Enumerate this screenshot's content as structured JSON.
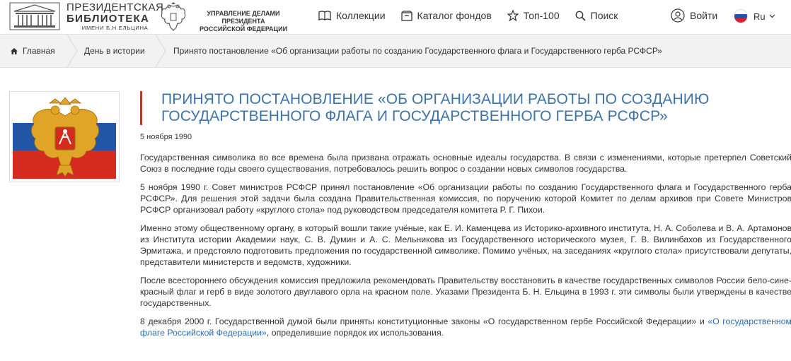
{
  "header": {
    "logo": {
      "line1": "ПРЕЗИДЕНТСКАЯ",
      "line2": "БИБЛИОТЕКА",
      "line3": "ИМЕНИ Б.Н.ЕЛЬЦИНА"
    },
    "udp": {
      "line1": "УПРАВЛЕНИЕ ДЕЛАМИ ПРЕЗИДЕНТА",
      "line2": "РОССИЙСКОЙ ФЕДЕРАЦИИ"
    },
    "nav": {
      "collections": "Коллекции",
      "catalog": "Каталог фондов",
      "top100": "Топ-100",
      "search": "Поиск"
    },
    "login": "Войти",
    "lang": "Ru"
  },
  "breadcrumb": {
    "home": "Главная",
    "section": "День в истории",
    "current": "Принято постановление «Об организации работы по созданию Государственного флага и Государственного герба РСФСР»"
  },
  "article": {
    "title_line1": "Принято постановление «Об организации работы по созданию",
    "title_line2": "Государственного флага и Государственного герба РСФСР»",
    "date": "5 ноября 1990",
    "p1": "Государственная символика во все времена была призвана отражать основные идеалы государства. В связи с изменениями, которые претерпел Советский Союз в последние годы своего существования, потребовалось решить вопрос о создании новых символов государства.",
    "p2": "5 ноября 1990 г. Совет министров РСФСР принял постановление «Об организации работы по созданию Государственного флага и Государственного герба РСФСР». Для решения этой задачи была создана Правительственная комиссия, по поручению которой Комитет по делам архивов при Совете Министров РСФСР организовал работу «круглого стола» под руководством председателя комитета Р. Г. Пихои.",
    "p3": "Именно этому общественному органу, в который вошли такие учёные, как Е. И. Каменцева из Историко-архивного института, Н. А. Соболева и В. А. Артамонов из Института истории Академии наук, С. В. Думин и А. С. Мельникова из Государственного исторического музея, Г. В. Вилинбахов из Государственного Эрмитажа, и предстояло подготовить предложения по государственной символике. Помимо учёных, на заседаниях «круглого стола» присутствовали депутаты, представители министерств и ведомств, художники.",
    "p4": "После всестороннего обсуждения комиссия предложила рекомендовать Правительству восстановить в качестве государственных символов России бело-сине-красный флаг и герб в виде золотого двуглавого орла на красном поле. Указами Президента Б. Н. Ельцина в 1993 г. эти символы были утверждены в качестве государственных.",
    "p5_start": "8 декабря 2000 г. Государственной думой были приняты конституционные законы «О государственном гербе Российской Федерации» и ",
    "p5_link": "«О государственном флаге Российской Федерации»",
    "p5_end": ", определившие порядок их использования."
  },
  "colors": {
    "title": "#3d73a8",
    "accent": "#b83a2d",
    "link": "#2a6db0"
  }
}
